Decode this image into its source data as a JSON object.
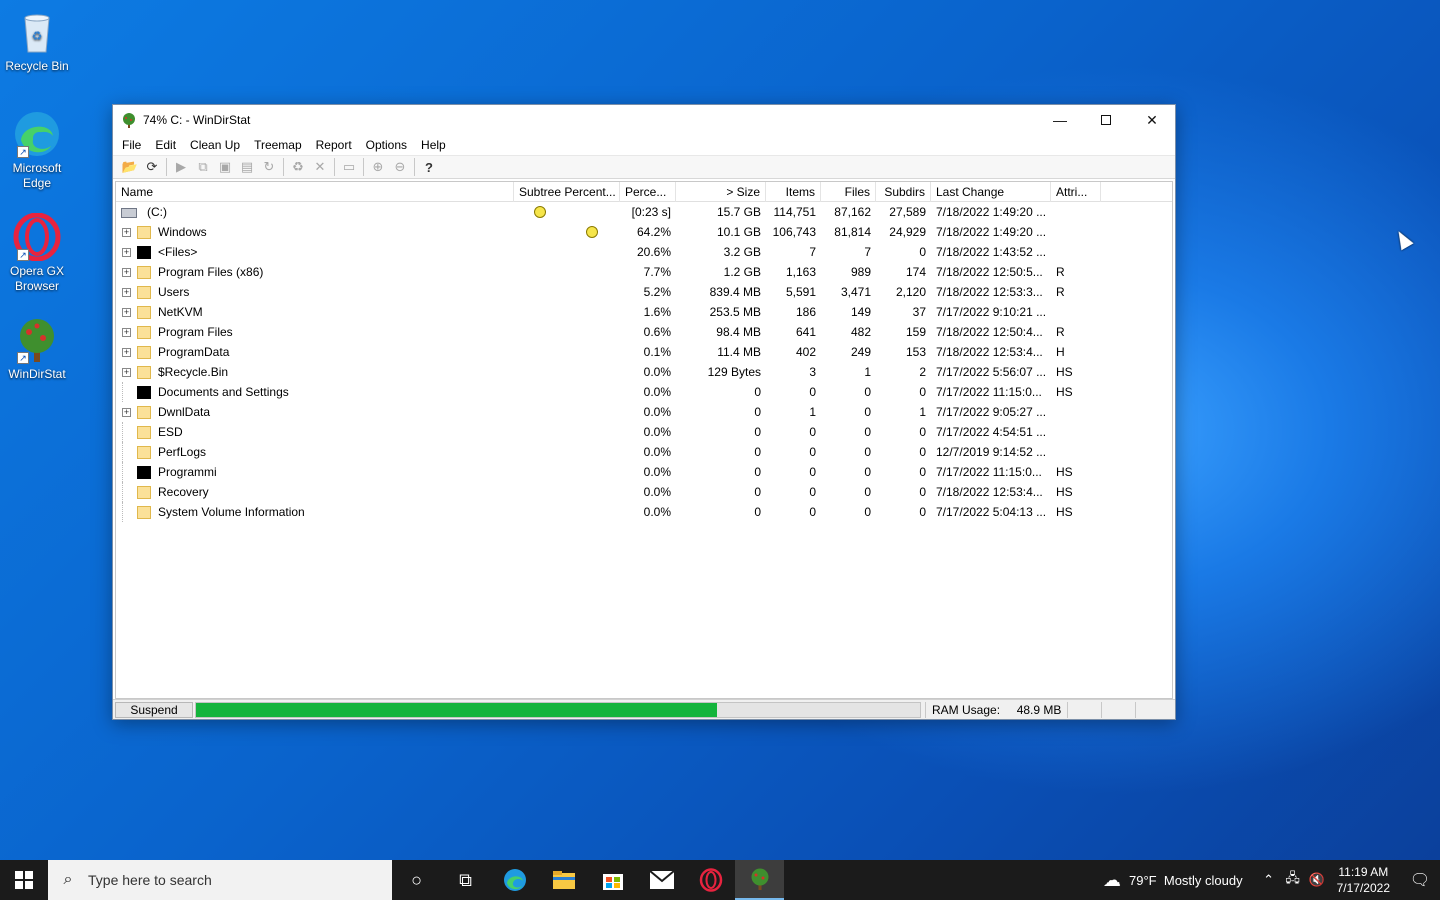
{
  "desktop": {
    "icons": [
      {
        "label": "Recycle Bin"
      },
      {
        "label": "Microsoft Edge"
      },
      {
        "label": "Opera GX Browser"
      },
      {
        "label": "WinDirStat"
      }
    ]
  },
  "window": {
    "title": "74% C: - WinDirStat",
    "menu": [
      "File",
      "Edit",
      "Clean Up",
      "Treemap",
      "Report",
      "Options",
      "Help"
    ],
    "columns": {
      "name": "Name",
      "subtree": "Subtree Percent...",
      "perc": "Perce...",
      "size": "> Size",
      "items": "Items",
      "files": "Files",
      "subdirs": "Subdirs",
      "last_change": "Last Change",
      "attr": "Attri..."
    },
    "root": {
      "name": "(C:)",
      "perc": "[0:23 s]",
      "size": "15.7 GB",
      "items": "114,751",
      "files": "87,162",
      "subdirs": "27,589",
      "last_change": "7/18/2022  1:49:20 ...",
      "attr": ""
    },
    "rows": [
      {
        "name": "Windows",
        "perc": "64.2%",
        "size": "10.1 GB",
        "items": "106,743",
        "files": "81,814",
        "subdirs": "24,929",
        "last_change": "7/18/2022  1:49:20 ...",
        "attr": ""
      },
      {
        "name": "<Files>",
        "perc": "20.6%",
        "size": "3.2 GB",
        "items": "7",
        "files": "7",
        "subdirs": "0",
        "last_change": "7/18/2022  1:43:52 ...",
        "attr": ""
      },
      {
        "name": "Program Files (x86)",
        "perc": "7.7%",
        "size": "1.2 GB",
        "items": "1,163",
        "files": "989",
        "subdirs": "174",
        "last_change": "7/18/2022  12:50:5...",
        "attr": "R"
      },
      {
        "name": "Users",
        "perc": "5.2%",
        "size": "839.4 MB",
        "items": "5,591",
        "files": "3,471",
        "subdirs": "2,120",
        "last_change": "7/18/2022  12:53:3...",
        "attr": "R"
      },
      {
        "name": "NetKVM",
        "perc": "1.6%",
        "size": "253.5 MB",
        "items": "186",
        "files": "149",
        "subdirs": "37",
        "last_change": "7/17/2022  9:10:21 ...",
        "attr": ""
      },
      {
        "name": "Program Files",
        "perc": "0.6%",
        "size": "98.4 MB",
        "items": "641",
        "files": "482",
        "subdirs": "159",
        "last_change": "7/18/2022  12:50:4...",
        "attr": "R"
      },
      {
        "name": "ProgramData",
        "perc": "0.1%",
        "size": "11.4 MB",
        "items": "402",
        "files": "249",
        "subdirs": "153",
        "last_change": "7/18/2022  12:53:4...",
        "attr": "H"
      },
      {
        "name": "$Recycle.Bin",
        "perc": "0.0%",
        "size": "129 Bytes",
        "items": "3",
        "files": "1",
        "subdirs": "2",
        "last_change": "7/17/2022  5:56:07 ...",
        "attr": "HS"
      },
      {
        "name": "Documents and Settings",
        "perc": "0.0%",
        "size": "0",
        "items": "0",
        "files": "0",
        "subdirs": "0",
        "last_change": "7/17/2022  11:15:0...",
        "attr": "HS"
      },
      {
        "name": "DwnlData",
        "perc": "0.0%",
        "size": "0",
        "items": "1",
        "files": "0",
        "subdirs": "1",
        "last_change": "7/17/2022  9:05:27 ...",
        "attr": ""
      },
      {
        "name": "ESD",
        "perc": "0.0%",
        "size": "0",
        "items": "0",
        "files": "0",
        "subdirs": "0",
        "last_change": "7/17/2022  4:54:51 ...",
        "attr": ""
      },
      {
        "name": "PerfLogs",
        "perc": "0.0%",
        "size": "0",
        "items": "0",
        "files": "0",
        "subdirs": "0",
        "last_change": "12/7/2019  9:14:52 ...",
        "attr": ""
      },
      {
        "name": "Programmi",
        "perc": "0.0%",
        "size": "0",
        "items": "0",
        "files": "0",
        "subdirs": "0",
        "last_change": "7/17/2022  11:15:0...",
        "attr": "HS"
      },
      {
        "name": "Recovery",
        "perc": "0.0%",
        "size": "0",
        "items": "0",
        "files": "0",
        "subdirs": "0",
        "last_change": "7/18/2022  12:53:4...",
        "attr": "HS"
      },
      {
        "name": "System Volume Information",
        "perc": "0.0%",
        "size": "0",
        "items": "0",
        "files": "0",
        "subdirs": "0",
        "last_change": "7/17/2022  5:04:13 ...",
        "attr": "HS"
      }
    ],
    "status": {
      "suspend_label": "Suspend",
      "progress_fraction": 0.72,
      "ram_label": "RAM Usage:",
      "ram_value": "48.9 MB"
    }
  },
  "taskbar": {
    "search_placeholder": "Type here to search",
    "weather_temp": "79°F",
    "weather_desc": "Mostly cloudy",
    "time": "11:19 AM",
    "date": "7/17/2022"
  },
  "colors": {
    "accent_progress": "#14b43c",
    "folder": "#fbe199"
  }
}
